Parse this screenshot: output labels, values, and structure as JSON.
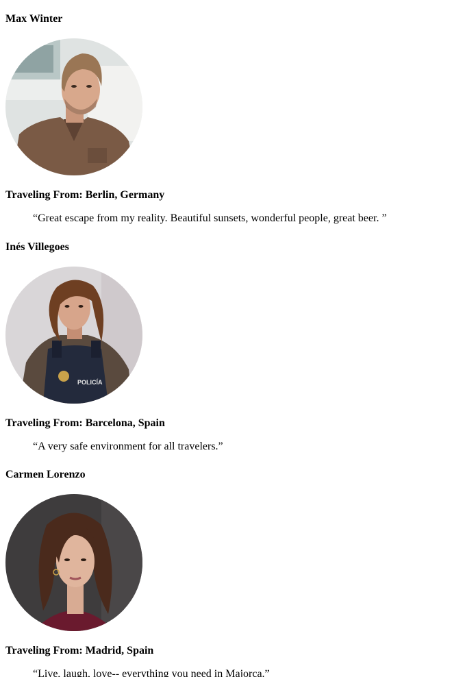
{
  "testimonials": [
    {
      "name": "Max Winter",
      "origin": "Traveling From: Berlin, Germany",
      "quote": "“Great escape from my reality. Beautiful sunsets, wonderful people, great beer. ”"
    },
    {
      "name": "Inés Villegoes",
      "origin": "Traveling From: Barcelona, Spain",
      "quote": "“A very safe environment for all travelers.”",
      "vest_text": "POLICÍA"
    },
    {
      "name": "Carmen Lorenzo",
      "origin": "Traveling From: Madrid, Spain",
      "quote": "“Live, laugh, love-- everything you need in Majorca.”"
    }
  ],
  "colors": {
    "text": "#000000",
    "background": "#ffffff"
  }
}
